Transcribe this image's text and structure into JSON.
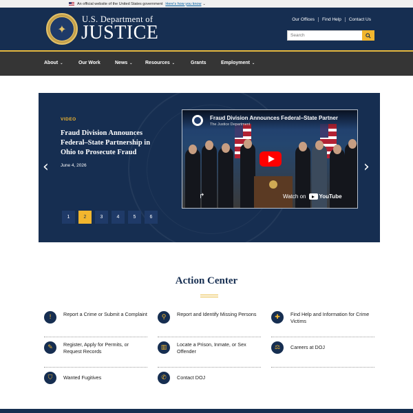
{
  "gov_banner": {
    "text": "An official website of the United States government",
    "link": "Here's how you know"
  },
  "header": {
    "logo_line1": "U.S. Department of",
    "logo_line2": "JUSTICE",
    "util_links": [
      "Our Offices",
      "Find Help",
      "Contact Us"
    ],
    "search_placeholder": "Search"
  },
  "nav": {
    "items": [
      {
        "label": "About",
        "dropdown": true
      },
      {
        "label": "Our Work",
        "dropdown": false
      },
      {
        "label": "News",
        "dropdown": true
      },
      {
        "label": "Resources",
        "dropdown": true
      },
      {
        "label": "Grants",
        "dropdown": false
      },
      {
        "label": "Employment",
        "dropdown": true
      }
    ]
  },
  "hero": {
    "tag": "VIDEO",
    "title": "Fraud Division Announces Federal–State Partnership in Ohio to Prosecute Fraud",
    "date": "June 4, 2026",
    "video": {
      "title": "Fraud Division Announces Federal–State Partner",
      "channel": "The Justice Department",
      "watch_on": "Watch on",
      "platform": "YouTube"
    },
    "pages": [
      "1",
      "2",
      "3",
      "4",
      "5",
      "6"
    ],
    "active_page": "2",
    "prev_icon": "chevron-left-icon",
    "next_icon": "chevron-right-icon"
  },
  "action_center": {
    "title": "Action Center",
    "items": [
      {
        "label": "Report a Crime or Submit a Complaint",
        "icon": "exclamation-icon"
      },
      {
        "label": "Report and Identify Missing Persons",
        "icon": "magnifier-icon"
      },
      {
        "label": "Find Help and Information for Crime Victims",
        "icon": "first-aid-icon"
      },
      {
        "label": "Register, Apply for Permits, or Request Records",
        "icon": "document-icon"
      },
      {
        "label": "Locate a Prison, Inmate, or Sex Offender",
        "icon": "building-icon"
      },
      {
        "label": "Careers at DOJ",
        "icon": "scales-icon"
      },
      {
        "label": "Wanted Fugitives",
        "icon": "badge-icon"
      },
      {
        "label": "Contact DOJ",
        "icon": "phone-icon"
      }
    ]
  },
  "colors": {
    "navy": "#162e51",
    "gold": "#f2b62e",
    "nav_bg": "#353535"
  }
}
